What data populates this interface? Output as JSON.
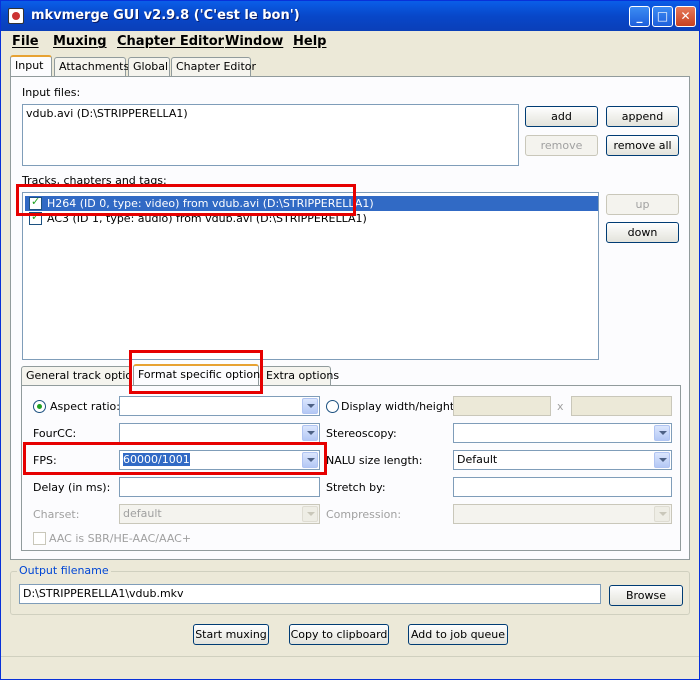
{
  "window": {
    "title": "mkvmerge GUI v2.9.8 ('C'est le bon')"
  },
  "menu": [
    "File",
    "Muxing",
    "Chapter Editor",
    "Window",
    "Help"
  ],
  "main_tabs": [
    "Input",
    "Attachments",
    "Global",
    "Chapter Editor"
  ],
  "input": {
    "files_label": "Input files:",
    "files": [
      "vdub.avi (D:\\STRIPPERELLA1)"
    ],
    "add": "add",
    "append": "append",
    "remove": "remove",
    "remove_all": "remove all",
    "tracks_label": "Tracks, chapters and tags:",
    "tracks": [
      {
        "text": "H264 (ID 0, type: video) from vdub.avi (D:\\STRIPPERELLA1)",
        "checked": true,
        "selected": true
      },
      {
        "text": "AC3 (ID 1, type: audio) from vdub.avi (D:\\STRIPPERELLA1)",
        "checked": true,
        "selected": false
      }
    ],
    "up": "up",
    "down": "down"
  },
  "track_tabs": [
    "General track options",
    "Format specific options",
    "Extra options"
  ],
  "format": {
    "aspect_ratio_label": "Aspect ratio:",
    "display_wh_label": "Display width/height:",
    "x_sep": "x",
    "fourcc_label": "FourCC:",
    "stereoscopy_label": "Stereoscopy:",
    "fps_label": "FPS:",
    "fps_value": "60000/1001",
    "nalu_label": "NALU size length:",
    "nalu_value": "Default",
    "delay_label": "Delay (in ms):",
    "stretch_label": "Stretch by:",
    "charset_label": "Charset:",
    "charset_value": "default",
    "compression_label": "Compression:",
    "aac_label": "AAC is SBR/HE-AAC/AAC+"
  },
  "output": {
    "group_label": "Output filename",
    "value": "D:\\STRIPPERELLA1\\vdub.mkv",
    "browse": "Browse"
  },
  "actions": {
    "start": "Start muxing",
    "copy": "Copy to clipboard",
    "job": "Add to job queue"
  },
  "colors": {
    "highlight": "#e60000",
    "selection": "#316ac5",
    "titlebar": "#0a5ee8"
  }
}
